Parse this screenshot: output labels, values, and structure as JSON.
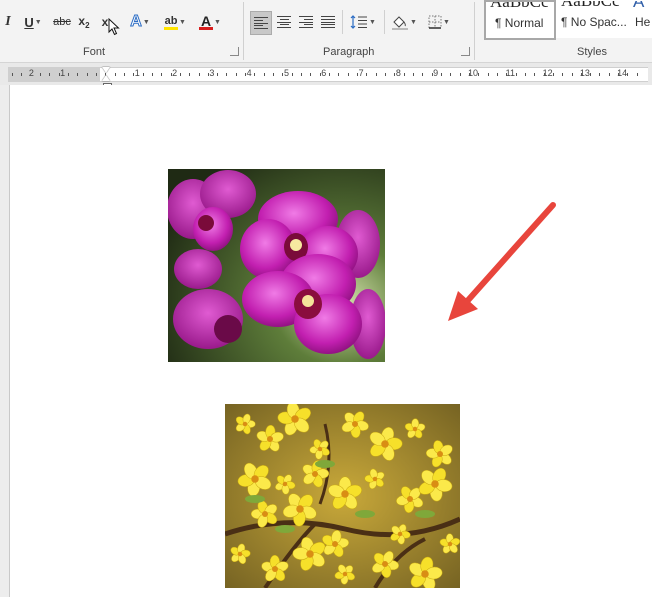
{
  "ribbon": {
    "font_group": {
      "label": "Font",
      "italic": "I",
      "underline": "U",
      "strikethrough": "abc",
      "subscript_main": "x",
      "subscript_small": "2",
      "superscript_main": "x",
      "text_effects": "A",
      "highlight": "ab",
      "font_color": "A",
      "highlight_color": "#ffe400",
      "font_color_value": "#d81e1e"
    },
    "paragraph_group": {
      "label": "Paragraph"
    },
    "styles_group": {
      "label": "Styles",
      "tiles": [
        {
          "sample": "AaBbCc",
          "name": "¶ Normal",
          "selected": true
        },
        {
          "sample": "AaBbCc",
          "name": "¶ No Spac...",
          "selected": false
        },
        {
          "sample": "A",
          "name": "He",
          "selected": false
        }
      ]
    }
  },
  "ruler": {
    "labels": [
      "2",
      "1",
      "1",
      "2",
      "3",
      "4",
      "5",
      "6",
      "7",
      "8",
      "9",
      "10",
      "11",
      "12",
      "13",
      "14"
    ]
  },
  "document": {
    "images": [
      {
        "name": "orchid-photo",
        "subject": "magenta orchid flowers"
      },
      {
        "name": "yellow-blossom-photo",
        "subject": "yellow apricot blossoms"
      }
    ],
    "annotation_arrow_color": "#e8453c"
  },
  "icons": {
    "cursor": "mouse-pointer-icon",
    "align_left": "align-left-icon",
    "align_center": "align-center-icon",
    "align_right": "align-right-icon",
    "justify": "justify-icon",
    "line_spacing": "line-spacing-icon",
    "shading": "shading-bucket-icon",
    "borders": "borders-icon"
  }
}
